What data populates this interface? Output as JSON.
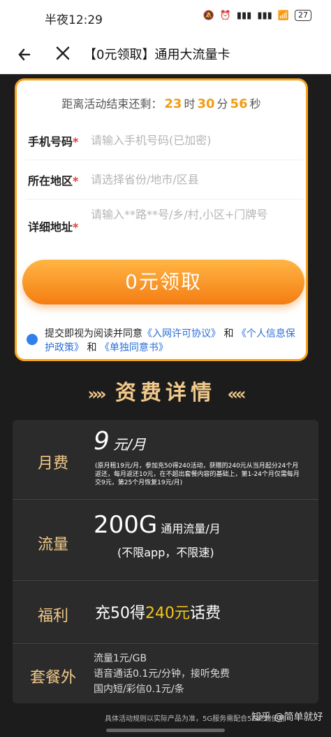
{
  "status": {
    "time": "半夜12:29",
    "battery": "27",
    "icons": [
      "mute-icon",
      "alarm-icon",
      "signal-hd-icon",
      "signal-hd-icon",
      "wifi-icon",
      "battery-icon"
    ]
  },
  "nav": {
    "title": "【0元领取】通用大流量卡",
    "back_icon": "arrow-left-icon",
    "close_icon": "close-icon"
  },
  "form": {
    "countdown_prefix": "距离活动结束还剩：",
    "countdown_hours": "23",
    "hour_unit": "时",
    "countdown_minutes": "30",
    "minute_unit": "分",
    "countdown_seconds": "56",
    "second_unit": "秒",
    "fields": [
      {
        "label": "手机号码",
        "required": "*",
        "placeholder": "请输入手机号码(已加密)"
      },
      {
        "label": "所在地区",
        "required": "*",
        "placeholder": "请选择省份/地市/区县"
      },
      {
        "label": "详细地址",
        "required": "*",
        "placeholder": "请输入**路**号/乡/村,小区+门牌号"
      }
    ],
    "submit_label": "0元领取",
    "agree_prefix": "提交即视为阅读并同意",
    "link1": "《入网许可协议》",
    "and1": "和",
    "link2": "《个人信息保护政策》",
    "and2": "和",
    "link3": "《单独同意书》"
  },
  "fees": {
    "title": "资费详情",
    "rows": [
      {
        "label": "月费",
        "main": "9",
        "unit": "元/月",
        "note": "(原月租19元/月，参加充50得240活动，获赠的240元从当月起分24个月返还，每月返还10元，在不超出套餐内容的基础上，第1-24个月仅需每月交9元，第25个月恢复19元/月)"
      },
      {
        "label": "流量",
        "main": "200G",
        "unit": "通用流量/月",
        "sub": "(不限app，不限速)"
      },
      {
        "label": "福利",
        "text_a": "充50得",
        "text_b": "240元",
        "text_c": "话费"
      },
      {
        "label": "套餐外",
        "lines": [
          "流量1元/GB",
          "语音通话0.1元/分钟，接听免费",
          "国内短/彩信0.1元/条"
        ]
      }
    ],
    "footnote": "具体活动规则以实际产品为准，5G服务需配合5G终端使用",
    "watermark": "知乎 @简单就好"
  }
}
